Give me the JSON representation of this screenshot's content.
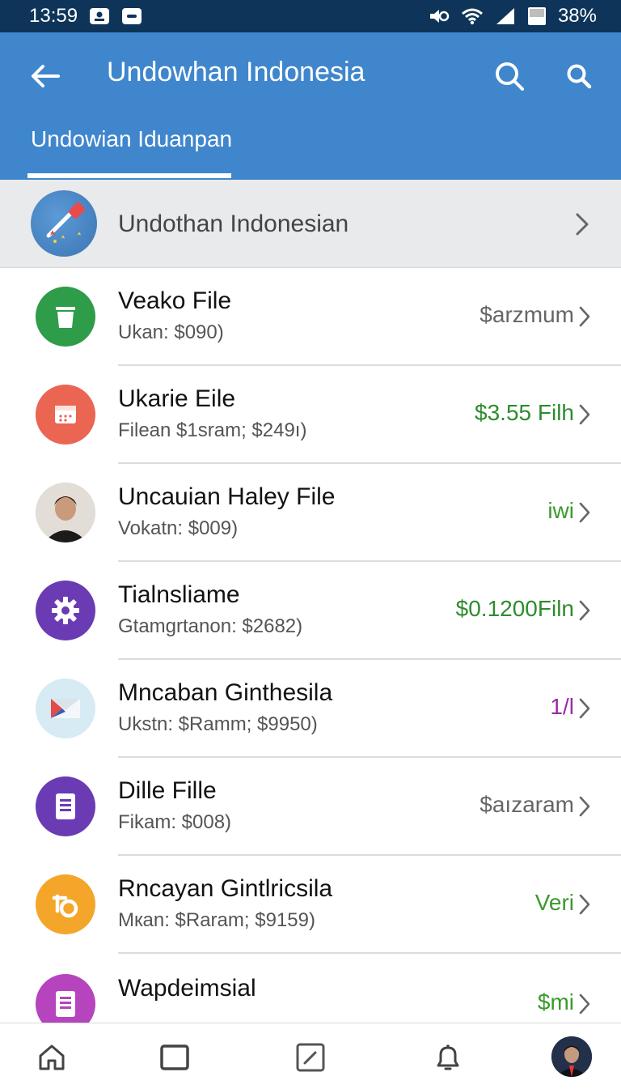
{
  "status_bar": {
    "time": "13:59",
    "battery_pct": "38%",
    "icons": [
      "notification-icon",
      "message-icon",
      "mute-icon",
      "wifi-icon",
      "signal-icon",
      "battery-icon"
    ]
  },
  "app_bar": {
    "title": "Undowhan Indonesia",
    "tab_label": "Undowian Iduanpan",
    "color": "#3f86cd"
  },
  "header_row": {
    "label": "Undothan Indonesian"
  },
  "rows": [
    {
      "title": "Veako File",
      "subtitle": "Ukan: $090)",
      "value": "$arzmum",
      "value_color": "#666666",
      "icon": "trash-icon",
      "icon_bg": "#2e9c48"
    },
    {
      "title": "Ukarie Eile",
      "subtitle": "Filean $1sram; $249ı)",
      "value": "$3.55 Filh",
      "value_color": "#2e8b2e",
      "icon": "calendar-icon",
      "icon_bg": "#ea6552"
    },
    {
      "title": "Uncauian Haley File",
      "subtitle": "Vokatn: $009)",
      "value": "iwi",
      "value_color": "#3a9a2a",
      "icon": "person-avatar",
      "icon_bg": "#d8d4d0"
    },
    {
      "title": "Tialnsliame",
      "subtitle": "Gtamgrtanon: $2682)",
      "value": "$0.1200Filn",
      "value_color": "#2e8b2e",
      "icon": "gear-icon",
      "icon_bg": "#6a3bb3"
    },
    {
      "title": "Mncaban Ginthesila",
      "subtitle": "Ukstn: $Ramm; $9950)",
      "value": "1/l",
      "value_color": "#9b2aa8",
      "icon": "mail-icon",
      "icon_bg": "#d6ebf4"
    },
    {
      "title": "Dille Fille",
      "subtitle": "Fikam: $008)",
      "value": "$aızaram",
      "value_color": "#666666",
      "icon": "document-icon",
      "icon_bg": "#6a3bb3"
    },
    {
      "title": "Rncayan Gintlricsila",
      "subtitle": "Mкan: $Raram; $9159)",
      "value": "Veri",
      "value_color": "#3a9a2a",
      "icon": "ring-icon",
      "icon_bg": "#f3a62a"
    },
    {
      "title": "Wapdeimsial",
      "subtitle": "",
      "value": "$mi",
      "value_color": "#3a9a2a",
      "icon": "document-icon",
      "icon_bg": "#b544be"
    }
  ],
  "bottom_nav": {
    "items": [
      "home-icon",
      "window-icon",
      "edit-icon",
      "bell-icon",
      "profile-avatar"
    ]
  }
}
